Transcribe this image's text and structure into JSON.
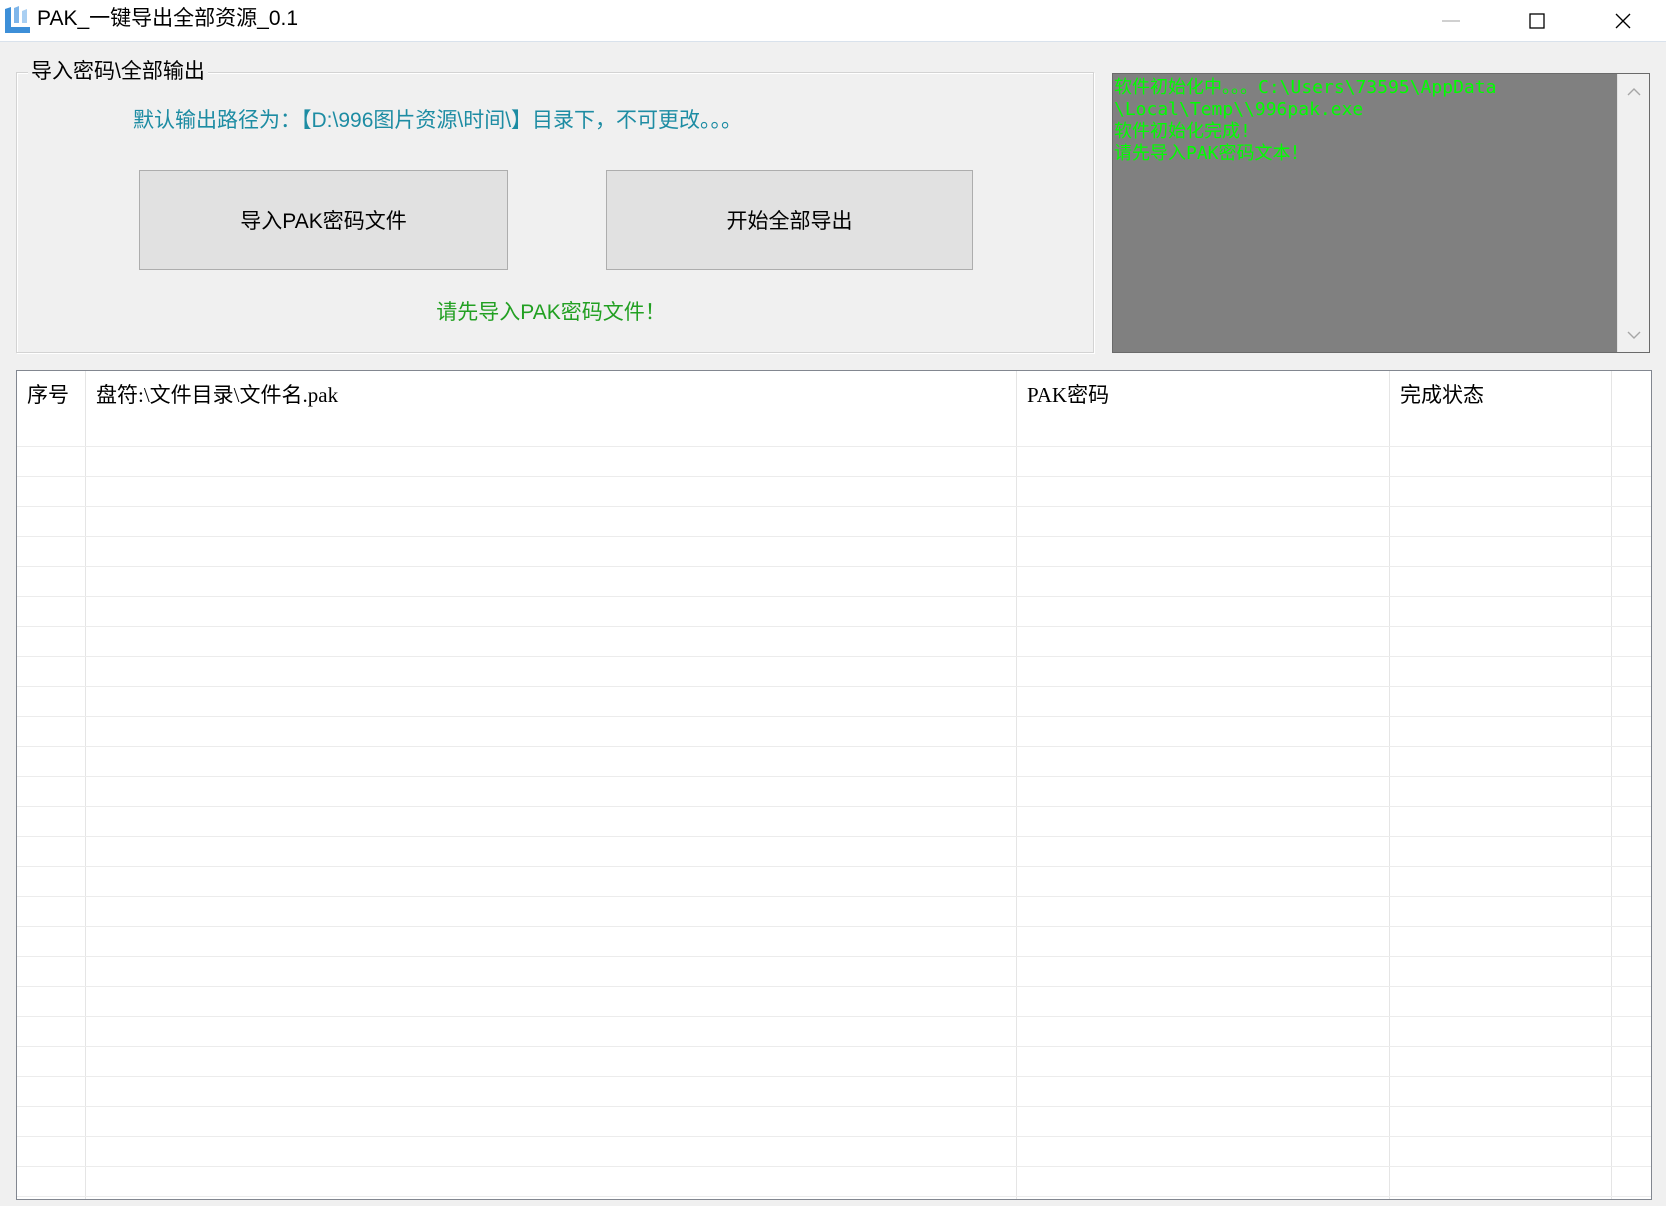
{
  "window": {
    "title": "PAK_一键导出全部资源_0.1",
    "app_icon": "app-icon",
    "controls": {
      "minimize_icon": "minimize-icon",
      "maximize_icon": "maximize-icon",
      "close_icon": "close-icon"
    }
  },
  "group": {
    "label": "导入密码\\全部输出",
    "path_note": "默认输出路径为：【D:\\996图片资源\\时间\\】目录下，不可更改。。。",
    "import_button_label": "导入PAK密码文件",
    "export_button_label": "开始全部导出",
    "status_message": "请先导入PAK密码文件！"
  },
  "log": {
    "lines": [
      "软件初始化中。。。C:\\Users\\73595\\AppData",
      "\\Local\\Temp\\\\996pak.exe",
      "软件初始化完成!",
      "请先导入PAK密码文本！"
    ],
    "scroll_icons": [
      "chevron-up-icon",
      "chevron-down-icon"
    ]
  },
  "table": {
    "columns": [
      "序号",
      "盘符:\\文件目录\\文件名.pak",
      "PAK密码",
      "完成状态"
    ],
    "rows": []
  },
  "colors": {
    "path_note": "#1d8ca3",
    "status_message": "#22a022",
    "log_text": "#00ff00",
    "log_background": "#808080",
    "app_icon": "#3d8fd8"
  }
}
